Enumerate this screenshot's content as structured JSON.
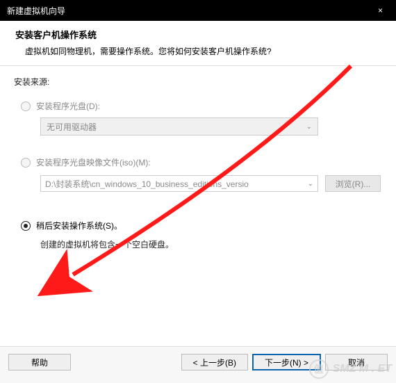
{
  "window": {
    "title": "新建虚拟机向导",
    "close_icon": "×"
  },
  "header": {
    "title": "安装客户机操作系统",
    "description": "虚拟机如同物理机，需要操作系统。您将如何安装客户机操作系统?"
  },
  "content": {
    "source_label": "安装来源:",
    "option_disc": {
      "label": "安装程序光盘(D):",
      "dropdown_value": "无可用驱动器",
      "dropdown_arrow": "⌄"
    },
    "option_iso": {
      "label": "安装程序光盘映像文件(iso)(M):",
      "path_value": "D:\\封装系统\\cn_windows_10_business_editions_versio",
      "dropdown_arrow": "⌄",
      "browse_label": "浏览(R)..."
    },
    "option_later": {
      "label": "稍后安装操作系统(S)。",
      "note": "创建的虚拟机将包含一个空白硬盘。"
    }
  },
  "footer": {
    "help_label": "帮助",
    "back_label": "< 上一步(B)",
    "next_label": "下一步(N) >",
    "cancel_label": "取消"
  },
  "watermark": {
    "circle": "值",
    "text": "SMZ M . ET"
  }
}
